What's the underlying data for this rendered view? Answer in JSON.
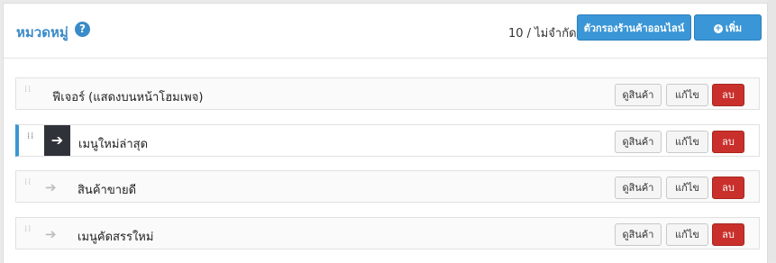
{
  "header": {
    "title": "หมวดหมู่",
    "help_icon": "question-circle-icon",
    "count_text": "10 / ไม่จำกัด",
    "filter_button": "ตัวกรองร้านค้าออนไลน์",
    "add_button": "เพิ่ม",
    "add_icon": "plus-circle-icon"
  },
  "colors": {
    "title": "#3a8bc8",
    "primary_button": "#3a96d6",
    "delete_button": "#c9302c",
    "active_marker": "#3a96d6"
  },
  "categories": [
    {
      "label": "ฟีเจอร์ (แสดงบนหน้าโฮมเพจ)",
      "indent": 0,
      "active": false,
      "view": "ดูสินค้า",
      "edit": "แก้ไข",
      "delete": "ลบ"
    },
    {
      "label": "เมนูใหม่ล่าสุด",
      "indent": 1,
      "active": true,
      "view": "ดูสินค้า",
      "edit": "แก้ไข",
      "delete": "ลบ"
    },
    {
      "label": "สินค้าขายดี",
      "indent": 1,
      "active": false,
      "view": "ดูสินค้า",
      "edit": "แก้ไข",
      "delete": "ลบ"
    },
    {
      "label": "เมนูคัดสรรใหม่",
      "indent": 1,
      "active": false,
      "view": "ดูสินค้า",
      "edit": "แก้ไข",
      "delete": "ลบ"
    }
  ]
}
